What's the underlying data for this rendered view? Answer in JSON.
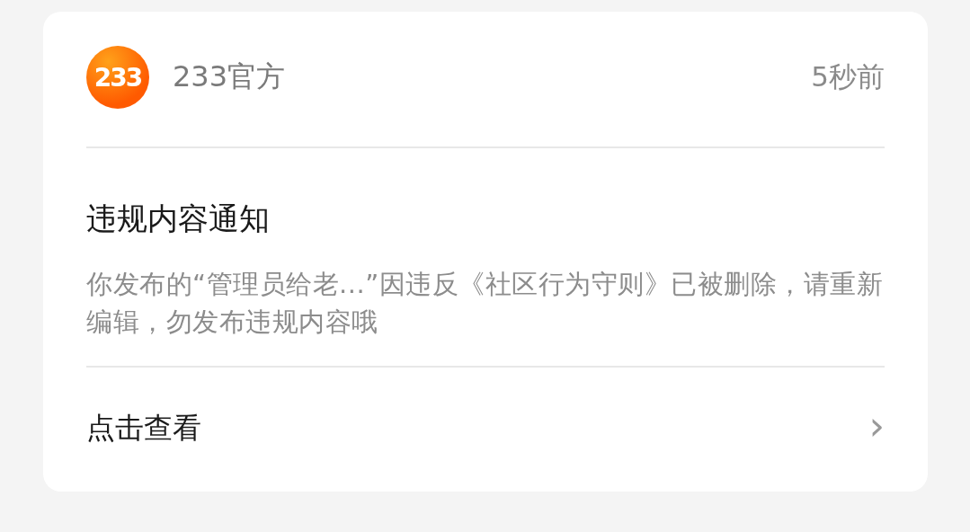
{
  "notification": {
    "sender": {
      "logo_text": "233",
      "name": "233官方"
    },
    "time": "5秒前",
    "title": "违规内容通知",
    "message": "你发布的“管理员给老...”因违反《社区行为守则》已被删除，请重新编辑，勿发布违规内容哦",
    "action": {
      "label": "点击查看",
      "chevron": "›"
    }
  }
}
